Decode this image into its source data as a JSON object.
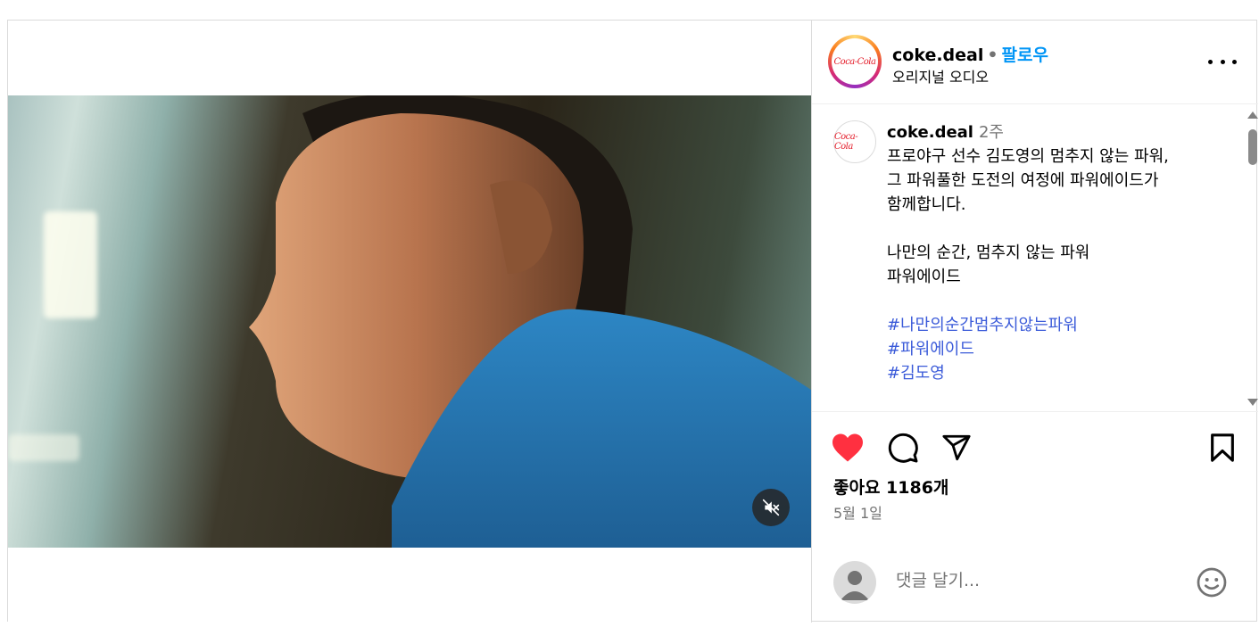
{
  "post": {
    "username": "coke.deal",
    "separator": "•",
    "follow_label": "팔로우",
    "audio_label": "오리지널 오디오",
    "brand_logo_text": "Coca-Cola",
    "caption": {
      "username": "coke.deal",
      "time_ago": "2주",
      "lines": [
        "프로야구 선수 김도영의 멈추지 않는 파워,",
        "그 파워풀한 도전의 여정에 파워에이드가",
        "함께합니다.",
        "",
        "나만의 순간, 멈추지 않는 파워",
        "파워에이드",
        ""
      ],
      "hashtags": [
        "#나만의순간멈추지않는파워",
        "#파워에이드",
        "#김도영"
      ]
    },
    "likes_text": "좋아요 1186개",
    "date_text": "5월 1일",
    "comment_placeholder": "댓글 달기...",
    "liked": true
  },
  "colors": {
    "accent_link": "#0095f6",
    "hashtag": "#3b5bd9",
    "heart": "#ff3040",
    "secondary_text": "#737373"
  },
  "icons": [
    "volume-off-icon",
    "more-icon",
    "heart-icon",
    "comment-icon",
    "share-icon",
    "bookmark-icon",
    "emoji-icon"
  ]
}
